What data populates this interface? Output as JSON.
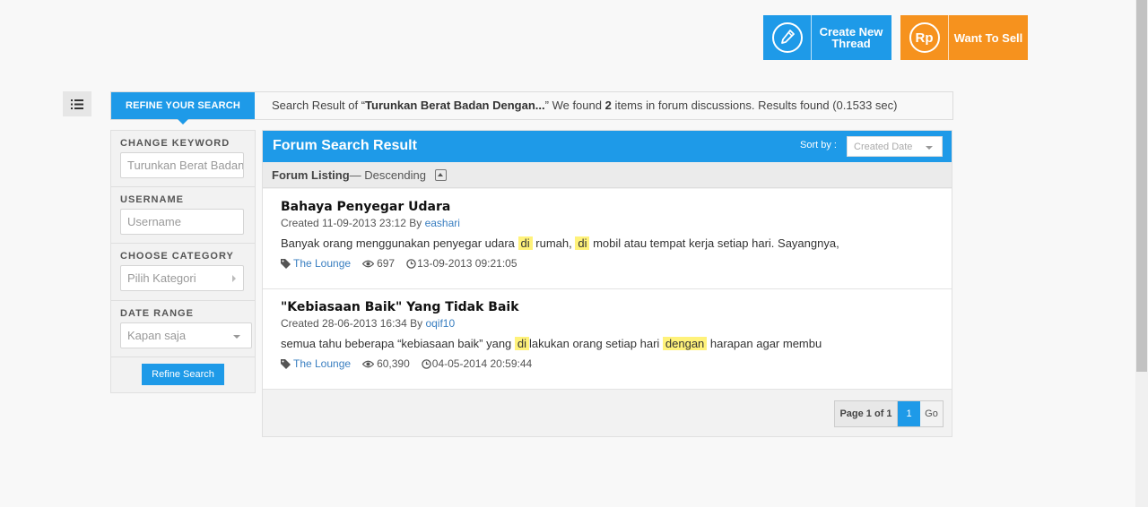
{
  "top_actions": {
    "create_thread": "Create New Thread",
    "want_to_sell": "Want To Sell",
    "sell_icon_text": "Rp"
  },
  "refine": {
    "tab_label": "REFINE YOUR SEARCH",
    "button": "Refine Search",
    "keyword": {
      "label": "CHANGE KEYWORD",
      "value": "Turunkan Berat Badan Dengan"
    },
    "username": {
      "label": "USERNAME",
      "placeholder": "Username"
    },
    "category": {
      "label": "CHOOSE CATEGORY",
      "value": "Pilih Kategori"
    },
    "date_range": {
      "label": "DATE RANGE",
      "value": "Kapan saja"
    }
  },
  "summary": {
    "prefix": "Search Result of “",
    "query": "Turunkan Berat Badan Dengan...",
    "mid": "” We found ",
    "count": "2",
    "suffix": " items in forum discussions. Results found (0.1533 sec)"
  },
  "results": {
    "title": "Forum Search Result",
    "sort_label": "Sort by :",
    "sort_value": "Created Date",
    "listing_label": "Forum Listing",
    "listing_order": " — Descending",
    "threads": [
      {
        "title": "Bahaya Penyegar Udara",
        "created": "Created 11-09-2013 23:12 By ",
        "author": "eashari",
        "snip_1": "Banyak orang menggunakan penyegar udara ",
        "hl_1": "di",
        "snip_2": " rumah, ",
        "hl_2": "di",
        "snip_3": " mobil atau tempat kerja setiap hari. Sayangnya,",
        "category": "The Lounge",
        "views": "697",
        "last": "13-09-2013 09:21:05"
      },
      {
        "title": "\"Kebiasaan Baik\" Yang Tidak Baik",
        "created": "Created 28-06-2013 16:34 By ",
        "author": "oqif10",
        "snip_1": "semua tahu beberapa “kebiasaan baik” yang ",
        "hl_1": "di",
        "snip_2": "lakukan orang setiap hari ",
        "hl_2": "dengan",
        "snip_3": " harapan agar membu",
        "category": "The Lounge",
        "views": "60,390",
        "last": "04-05-2014 20:59:44"
      }
    ],
    "pager": {
      "label": "Page 1 of 1",
      "current": "1",
      "go": "Go"
    }
  },
  "colors": {
    "primary": "#1e9ae8",
    "sell": "#f6921e",
    "highlight": "#fff27a",
    "link": "#3a7fc1"
  }
}
